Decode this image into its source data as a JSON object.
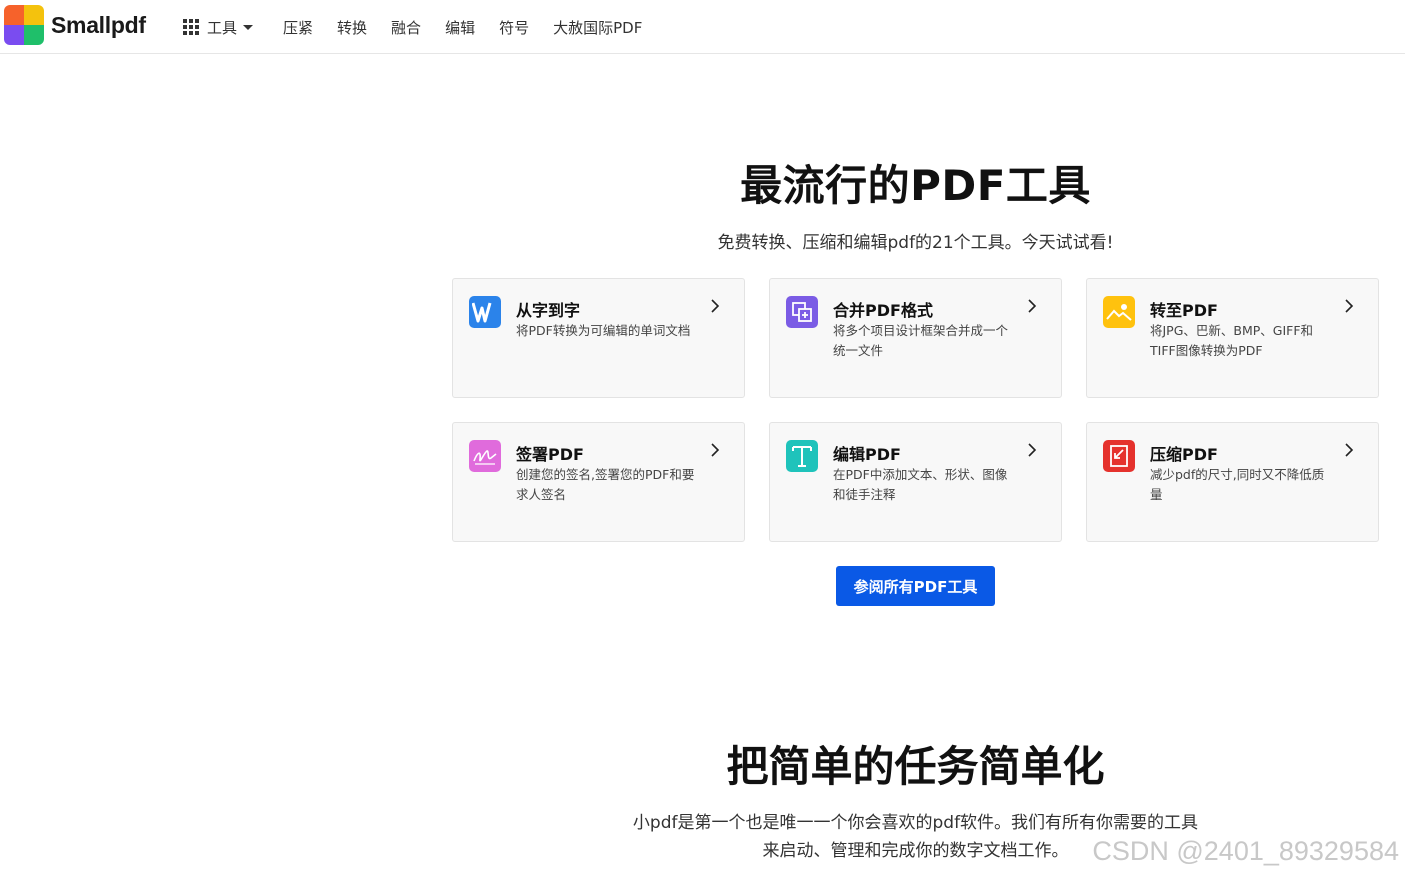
{
  "header": {
    "logo_text": "Smallpdf",
    "tools_label": "工具",
    "nav_links": [
      "压紧",
      "转换",
      "融合",
      "编辑",
      "符号",
      "大赦国际PDF"
    ]
  },
  "hero": {
    "title": "最流行的PDF工具",
    "subtitle": "免费转换、压缩和编辑pdf的21个工具。今天试试看!"
  },
  "cards": [
    {
      "title": "从字到字",
      "desc": "将PDF转换为可编辑的单词文档",
      "icon": "word-icon",
      "color": "#2b83ea"
    },
    {
      "title": "合并PDF格式",
      "desc": "将多个项目设计框架合并成一个统一文件",
      "icon": "merge-icon",
      "color": "#7b5ce5"
    },
    {
      "title": "转至PDF",
      "desc": "将JPG、巴新、BMP、GIFF和TIFF图像转换为PDF",
      "icon": "image-icon",
      "color": "#ffc20e"
    },
    {
      "title": "签署PDF",
      "desc": "创建您的签名,签署您的PDF和要求人签名",
      "icon": "signature-icon",
      "color": "#e06bdc"
    },
    {
      "title": "编辑PDF",
      "desc": "在PDF中添加文本、形状、图像和徒手注释",
      "icon": "text-icon",
      "color": "#1fc3bb"
    },
    {
      "title": "压缩PDF",
      "desc": "减少pdf的尺寸,同时又不降低质量",
      "icon": "compress-icon",
      "color": "#e5322d"
    }
  ],
  "cta_label": "参阅所有PDF工具",
  "section2": {
    "title": "把简单的任务简单化",
    "line1": "小pdf是第一个也是唯一一个你会喜欢的pdf软件。我们有所有你需要的工具",
    "line2": "来启动、管理和完成你的数字文档工作。"
  },
  "watermark": "CSDN @2401_89329584",
  "colors": {
    "accent": "#0a59e6"
  }
}
